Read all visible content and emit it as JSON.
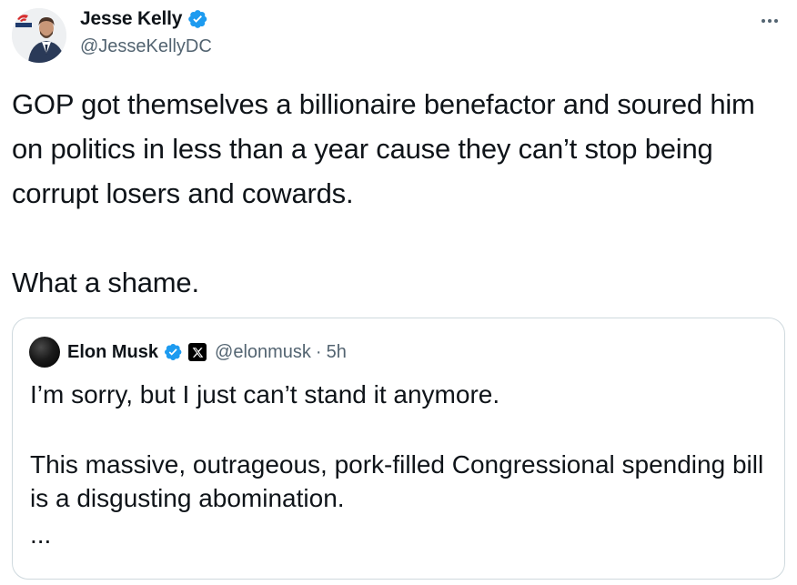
{
  "tweet": {
    "author": {
      "name": "Jesse Kelly",
      "handle": "@JesseKellyDC",
      "avatar_badge_text": "FIRST",
      "verified": true
    },
    "text_lines": [
      "GOP got themselves a billionaire benefactor and soured him on politics in less than a year cause they can’t stop being corrupt losers and cowards.",
      "What a shame."
    ],
    "more_icon": "more-horizontal-icon"
  },
  "quoted_tweet": {
    "author": {
      "name": "Elon Musk",
      "handle": "@elonmusk",
      "verified": true,
      "affiliate_badge": "x-logo-icon"
    },
    "separator": "·",
    "time": "5h",
    "text_lines": [
      "I’m sorry, but I just can’t stand it anymore.",
      "This massive, outrageous, pork-filled Congressional spending bill is a disgusting abomination.",
      "..."
    ]
  },
  "colors": {
    "verified_blue": "#1d9bf0",
    "text_primary": "#0f1419",
    "text_secondary": "#536471",
    "border": "#cfd9de",
    "avatar_badge_red": "#d62e2e"
  }
}
